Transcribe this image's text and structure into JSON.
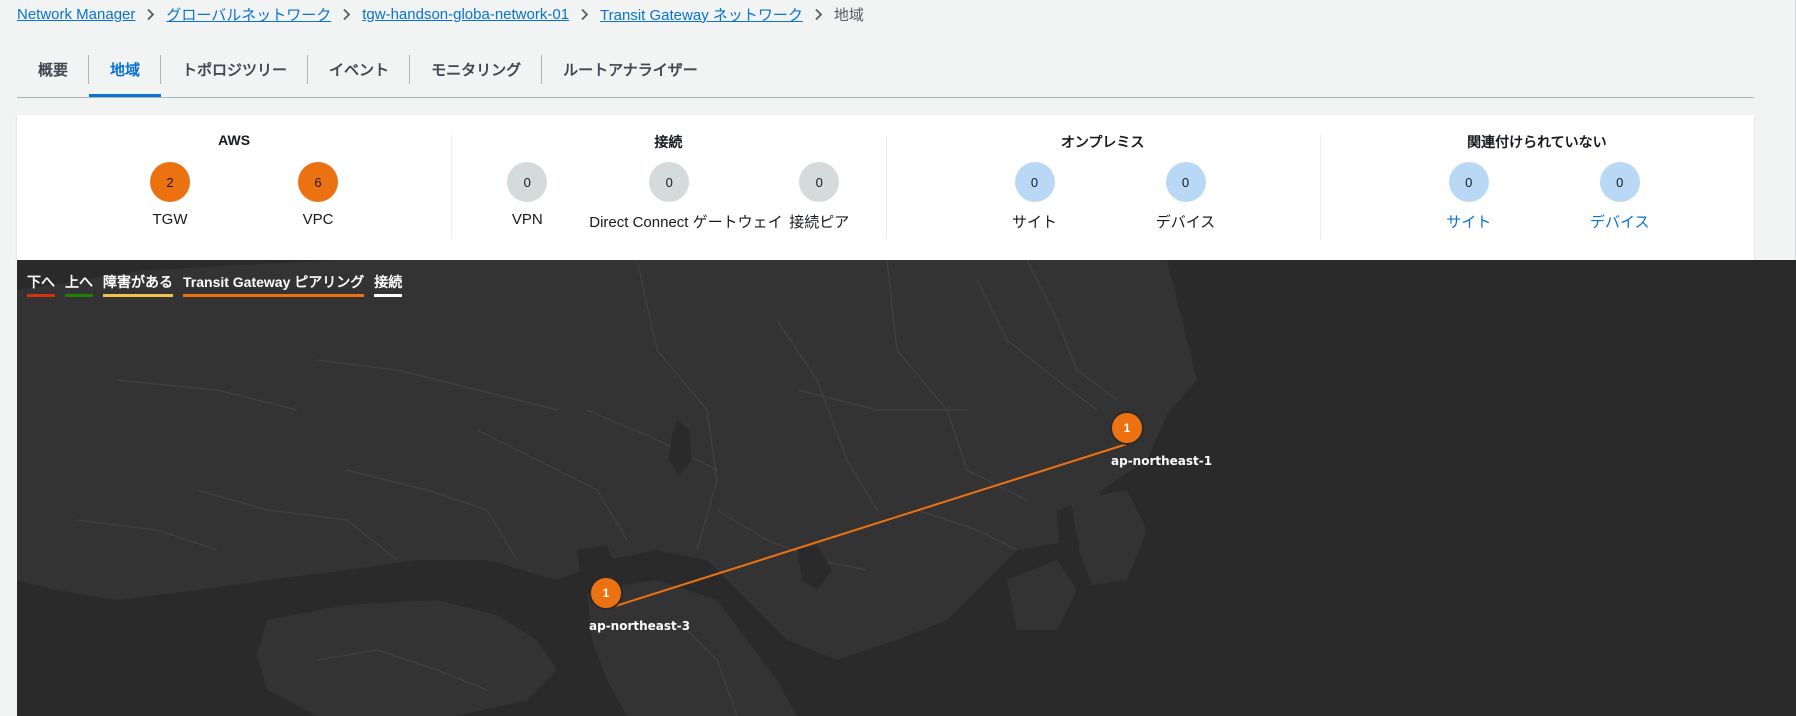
{
  "breadcrumb": {
    "items": [
      "Network Manager",
      "グローバルネットワーク",
      "tgw-handson-globa-network-01",
      "Transit Gateway ネットワーク"
    ],
    "current": "地域"
  },
  "tabs": [
    {
      "label": "概要",
      "active": false
    },
    {
      "label": "地域",
      "active": true
    },
    {
      "label": "トポロジツリー",
      "active": false
    },
    {
      "label": "イベント",
      "active": false
    },
    {
      "label": "モニタリング",
      "active": false
    },
    {
      "label": "ルートアナライザー",
      "active": false
    }
  ],
  "summary": {
    "aws": {
      "title": "AWS",
      "metrics": [
        {
          "value": "2",
          "label": "TGW"
        },
        {
          "value": "6",
          "label": "VPC"
        }
      ]
    },
    "connections": {
      "title": "接続",
      "metrics": [
        {
          "value": "0",
          "label": "VPN"
        },
        {
          "value": "0",
          "label": "Direct Connect ゲートウェイ"
        },
        {
          "value": "0",
          "label": "接続ピア"
        }
      ]
    },
    "onprem": {
      "title": "オンプレミス",
      "metrics": [
        {
          "value": "0",
          "label": "サイト"
        },
        {
          "value": "0",
          "label": "デバイス"
        }
      ]
    },
    "unassociated": {
      "title": "関連付けられていない",
      "metrics": [
        {
          "value": "0",
          "label": "サイト"
        },
        {
          "value": "0",
          "label": "デバイス"
        }
      ]
    }
  },
  "map": {
    "legend": [
      {
        "label": "下へ",
        "color": "#d13212"
      },
      {
        "label": "上へ",
        "color": "#1d8102"
      },
      {
        "label": "障害がある",
        "color": "#f2c14e"
      },
      {
        "label": "Transit Gateway ピアリング",
        "color": "#ec7211"
      },
      {
        "label": "接続",
        "color": "#ffffff"
      }
    ],
    "regions": [
      {
        "name": "ap-northeast-1",
        "count": "1"
      },
      {
        "name": "ap-northeast-3",
        "count": "1"
      }
    ],
    "colors": {
      "background": "#2a2a2b",
      "land": "#333334",
      "borders": "#444446",
      "peering": "#ec7211"
    }
  }
}
